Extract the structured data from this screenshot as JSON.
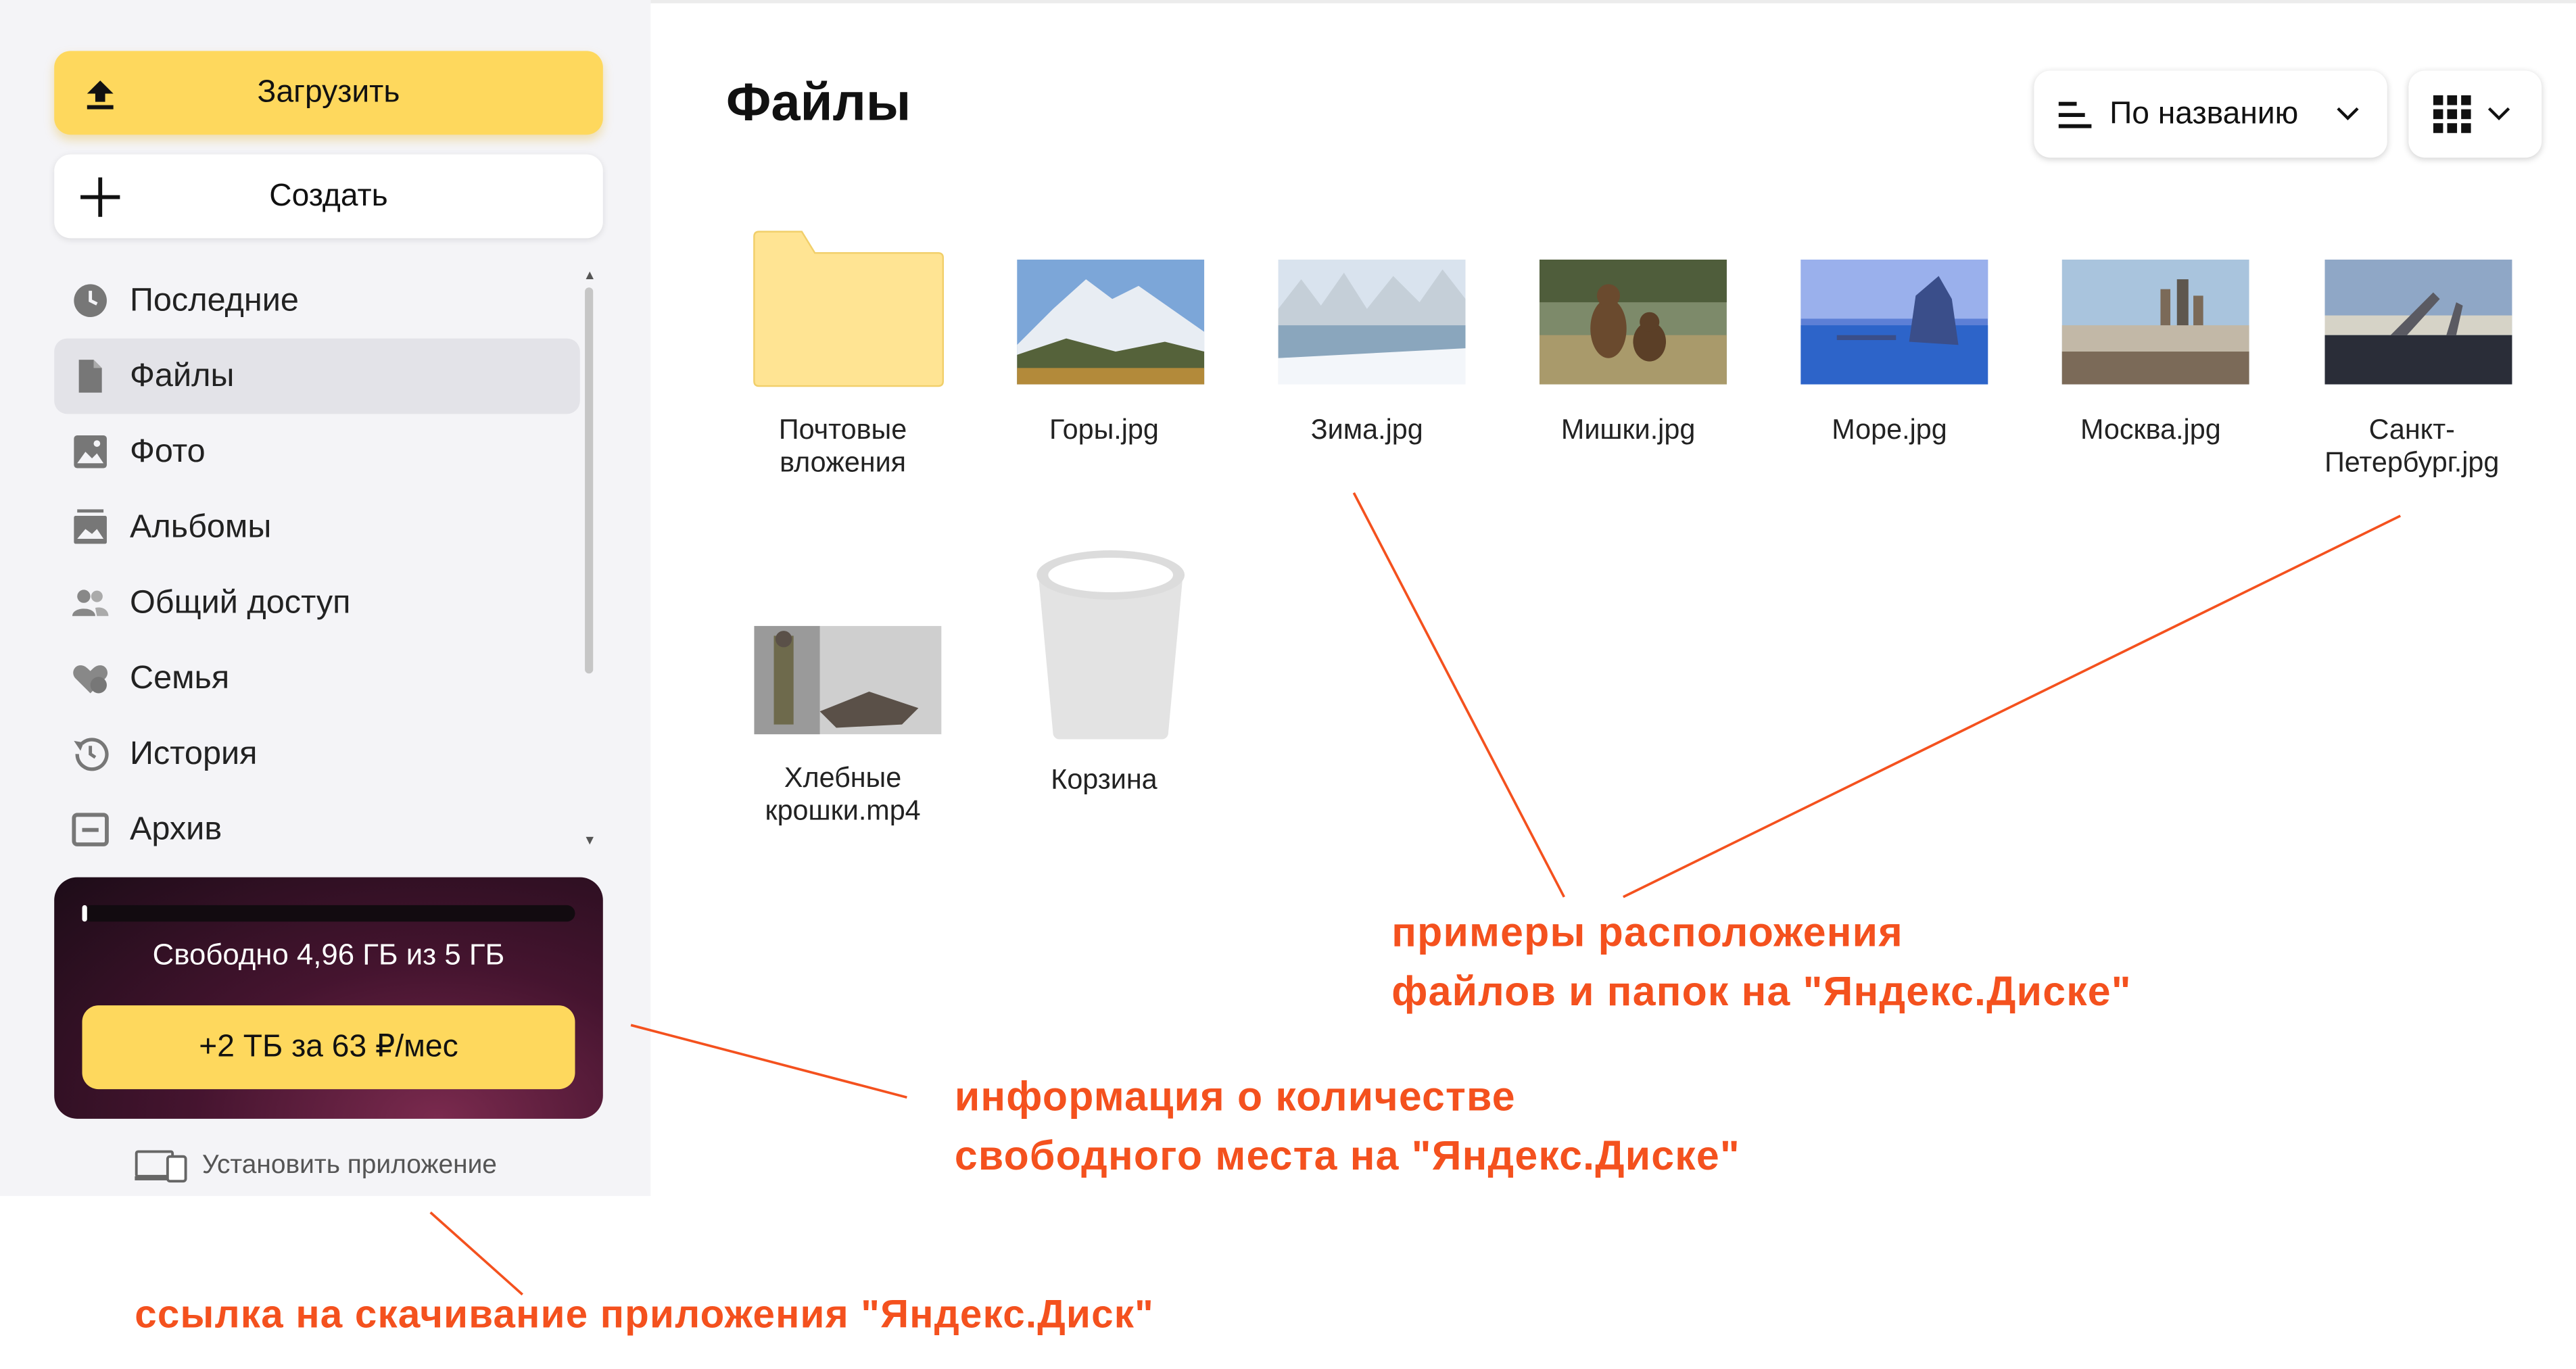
{
  "sidebar": {
    "upload_label": "Загрузить",
    "create_label": "Создать",
    "nav": [
      {
        "label": "Последние",
        "icon": "clock-icon"
      },
      {
        "label": "Файлы",
        "icon": "file-icon",
        "active": true
      },
      {
        "label": "Фото",
        "icon": "photo-icon"
      },
      {
        "label": "Альбомы",
        "icon": "albums-icon"
      },
      {
        "label": "Общий доступ",
        "icon": "shared-access-icon"
      },
      {
        "label": "Семья",
        "icon": "family-icon"
      },
      {
        "label": "История",
        "icon": "history-icon"
      },
      {
        "label": "Архив",
        "icon": "archive-icon"
      }
    ],
    "storage": {
      "text": "Свободно 4,96 ГБ из 5 ГБ",
      "used_fraction": 0.008,
      "buy_label": "+2 ТБ за 63 ₽/мес"
    },
    "install_label": "Установить приложение"
  },
  "main": {
    "title": "Файлы",
    "sort_label": "По названию",
    "view_icon": "grid-view-icon",
    "files": [
      {
        "name": "Почтовые вложения",
        "kind": "folder"
      },
      {
        "name": "Горы.jpg",
        "kind": "image",
        "palette": [
          "#7ca6d8",
          "#e8edf3",
          "#55623a",
          "#b38a3a"
        ]
      },
      {
        "name": "Зима.jpg",
        "kind": "image",
        "palette": [
          "#d9e3ee",
          "#f3f6fa",
          "#8aa6bd",
          "#c5cfd8"
        ]
      },
      {
        "name": "Мишки.jpg",
        "kind": "image",
        "palette": [
          "#7d8a6a",
          "#4f5d3b",
          "#6a4a2e",
          "#a99a6b"
        ]
      },
      {
        "name": "Море.jpg",
        "kind": "image",
        "palette": [
          "#5d7fd6",
          "#9ab0ec",
          "#2d64c9",
          "#3a4e8a"
        ]
      },
      {
        "name": "Москва.jpg",
        "kind": "image",
        "palette": [
          "#a9c4dd",
          "#c2b8a7",
          "#7b6a58",
          "#5e574e"
        ]
      },
      {
        "name": "Санкт-Петербург.jpg",
        "kind": "image",
        "palette": [
          "#8fa7c6",
          "#d6d3c7",
          "#2a2d38",
          "#5a5a62"
        ]
      },
      {
        "name": "Хлебные крошки.mp4",
        "kind": "video",
        "palette": [
          "#cfcfcf",
          "#9a9a9a",
          "#5a5048",
          "#6e6a4c"
        ]
      },
      {
        "name": "Корзина",
        "kind": "trash"
      }
    ]
  },
  "annotations": {
    "files_note": [
      "примеры расположения",
      "файлов и папок на \"Яндекс.Диске\""
    ],
    "storage_note": [
      "информация о количестве",
      "свободного места на \"Яндекс.Диске\""
    ],
    "app_note": "ссылка на скачивание приложения \"Яндекс.Диск\""
  },
  "colors": {
    "accent_yellow": "#fed85d",
    "annotation": "#f4511e",
    "storage_bg": "#45142f"
  }
}
